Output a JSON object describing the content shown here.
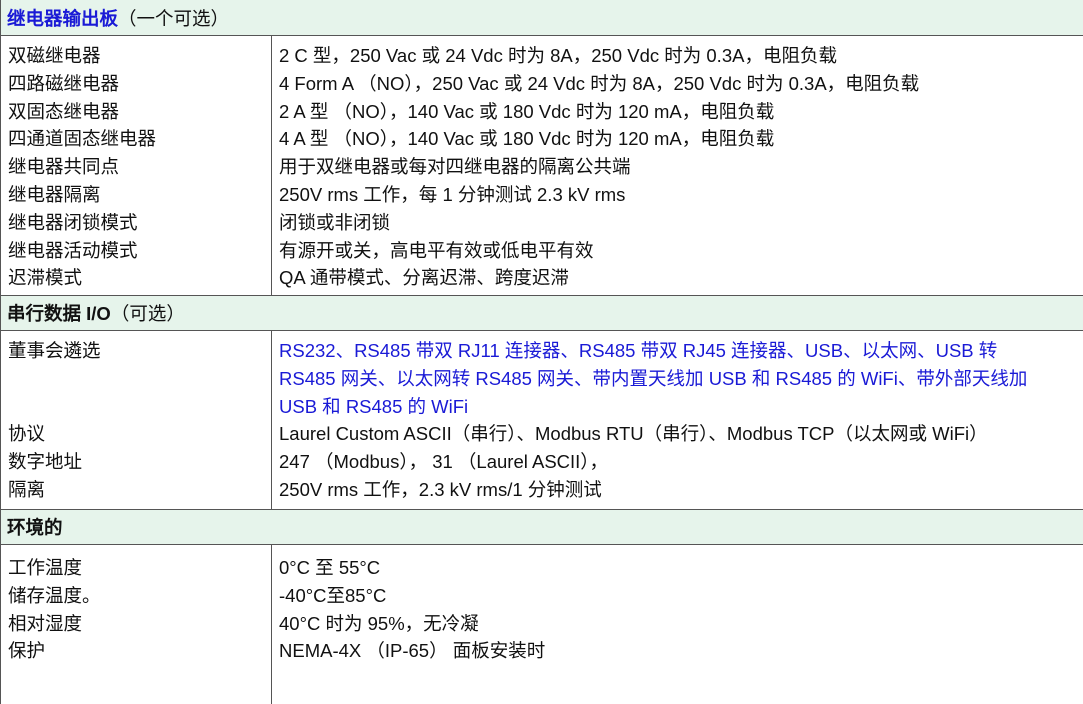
{
  "sections": {
    "relay": {
      "title": "继电器输出板",
      "note": "（一个可选）",
      "rows": [
        {
          "label": "双磁继电器",
          "value": "2 C 型，250 Vac 或 24 Vdc 时为 8A，250 Vdc 时为 0.3A，电阻负载"
        },
        {
          "label": "四路磁继电器",
          "value": "4 Form A （NO），250 Vac 或 24 Vdc 时为 8A，250 Vdc 时为 0.3A，电阻负载"
        },
        {
          "label": "双固态继电器",
          "value": "2 A 型 （NO），140 Vac 或 180 Vdc 时为 120 mA，电阻负载"
        },
        {
          "label": "四通道固态继电器",
          "value": "4 A 型 （NO），140 Vac 或 180 Vdc 时为 120 mA，电阻负载"
        },
        {
          "label": "继电器共同点",
          "value": "用于双继电器或每对四继电器的隔离公共端"
        },
        {
          "label": "继电器隔离",
          "value": "250V rms 工作，每 1 分钟测试 2.3 kV rms"
        },
        {
          "label": "继电器闭锁模式",
          "value": "闭锁或非闭锁"
        },
        {
          "label": "继电器活动模式",
          "value": "有源开或关，高电平有效或低电平有效"
        },
        {
          "label": "迟滞模式",
          "value": "QA 通带模式、分离迟滞、跨度迟滞"
        }
      ]
    },
    "serial": {
      "title": "串行数据 I/O",
      "note": "（可选）",
      "labels": [
        "董事会遴选",
        "",
        "",
        "协议",
        "数字地址",
        "隔离"
      ],
      "board_options": [
        "RS232、RS485 带双 RJ11 连接器、RS485 带双 RJ45 连接器、USB、以太网、USB 转",
        "RS485 网关、以太网转 RS485 网关、带内置天线加 USB 和 RS485 的 WiFi、带外部天线加",
        "USB 和 RS485 的 WiFi"
      ],
      "protocol": "Laurel Custom ASCII（串行）、Modbus RTU（串行）、Modbus TCP（以太网或 WiFi）",
      "address": "247 （Modbus）， 31 （Laurel ASCII），",
      "isolation": "250V rms 工作，2.3 kV rms/1 分钟测试"
    },
    "environment": {
      "title": "环境的",
      "rows": [
        {
          "label": "工作温度",
          "value": "0°C 至 55°C"
        },
        {
          "label": "储存温度。",
          "value": "-40°C至85°C"
        },
        {
          "label": "相对湿度",
          "value": "40°C 时为 95%，无冷凝"
        },
        {
          "label": "保护",
          "value": "NEMA-4X （IP-65） 面板安装时"
        }
      ]
    }
  },
  "colors": {
    "section_background": "#e6f4eb",
    "link_blue": "#1a1ad6",
    "border": "#555555"
  }
}
